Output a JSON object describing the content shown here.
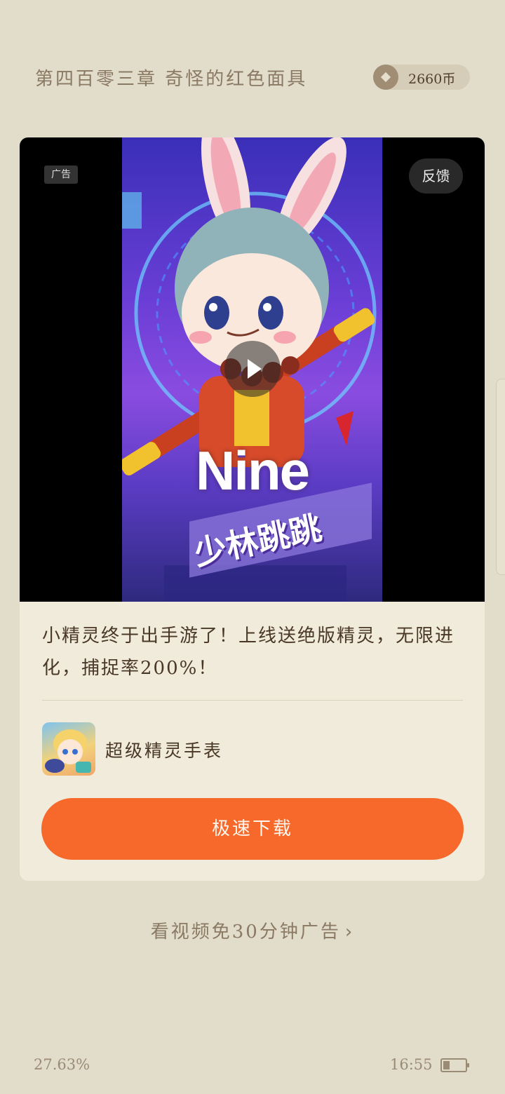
{
  "header": {
    "chapter_title": "第四百零三章 奇怪的红色面具",
    "coin_balance": "2660币",
    "coin_icon": "coin-icon"
  },
  "ad": {
    "badge": "广告",
    "feedback_label": "反馈",
    "video_overlay_text": "Nine",
    "game_title_art": "少林跳跳",
    "description": "小精灵终于出手游了！上线送绝版精灵，无限进化，捕捉率200%！",
    "app_name": "超级精灵手表",
    "download_label": "极速下载"
  },
  "footer": {
    "watch_video_link": "看视频免30分钟广告",
    "reading_progress": "27.63%",
    "time": "16:55",
    "battery_level": 0.3
  },
  "colors": {
    "background": "#e2dccb",
    "card": "#f1ebdc",
    "accent": "#f6692b",
    "muted_text": "#8b7a63"
  }
}
